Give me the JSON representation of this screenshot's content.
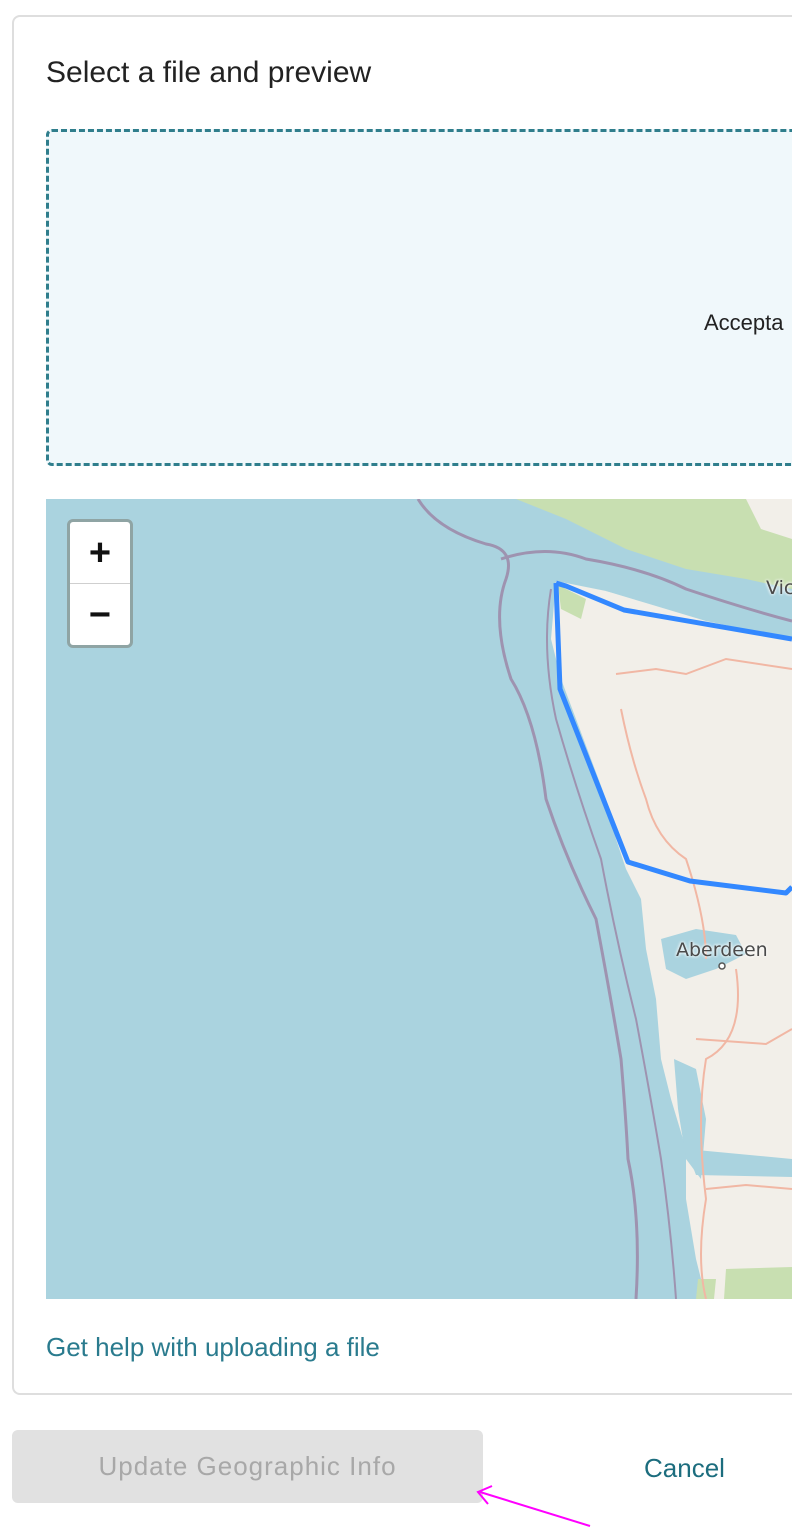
{
  "dialog": {
    "title": "Select a file and preview"
  },
  "dropzone": {
    "visible_text": "Accepta"
  },
  "map": {
    "zoom_in_label": "+",
    "zoom_out_label": "−",
    "labels": {
      "victoria": "Vic",
      "aberdeen": "Aberdeen"
    },
    "colors": {
      "water": "#aad3df",
      "land": "#f2efe9",
      "park": "#c8dfb1",
      "boundary": "#3388ff"
    }
  },
  "help_link": {
    "label": "Get help with uploading a file"
  },
  "actions": {
    "update_label": "Update Geographic Info",
    "cancel_label": "Cancel"
  }
}
